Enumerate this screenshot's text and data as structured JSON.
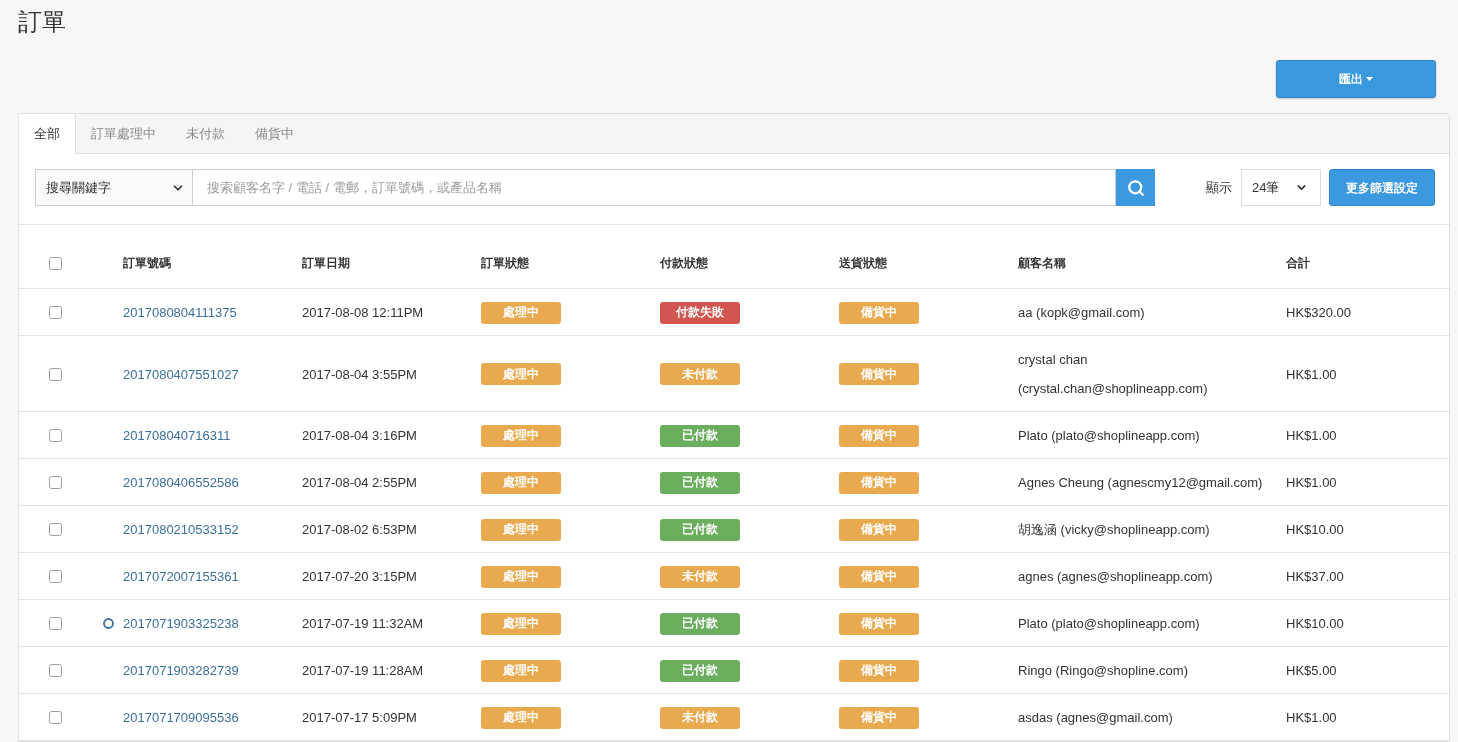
{
  "page": {
    "title": "訂單"
  },
  "export_button": {
    "label": "匯出"
  },
  "tabs": [
    {
      "label": "全部",
      "selected": true
    },
    {
      "label": "訂單處理中",
      "selected": false
    },
    {
      "label": "未付款",
      "selected": false
    },
    {
      "label": "備貨中",
      "selected": false
    }
  ],
  "search": {
    "field_type": "搜尋關鍵字",
    "placeholder": "搜索顧客名字 / 電話 / 電郵，訂單號碼，或產品名稱"
  },
  "page_size": {
    "label": "顯示",
    "value": "24筆"
  },
  "filter_button": {
    "label": "更多篩選設定"
  },
  "table": {
    "select_all_checked": false,
    "columns": [
      "訂單號碼",
      "訂單日期",
      "訂單狀態",
      "付款狀態",
      "送貨狀態",
      "顧客名稱",
      "合計"
    ],
    "rows": [
      {
        "checked": false,
        "marked": false,
        "order_no": "2017080804111375",
        "date": "2017-08-08 12:11PM",
        "order_status": {
          "label": "處理中",
          "color": "#e8a94f"
        },
        "payment_status": {
          "label": "付款失敗",
          "color": "#d0564f"
        },
        "delivery_status": {
          "label": "備貨中",
          "color": "#e8a94f"
        },
        "customer": "aa (kopk@gmail.com)",
        "total": "HK$320.00"
      },
      {
        "checked": false,
        "marked": false,
        "order_no": "2017080407551027",
        "date": "2017-08-04 3:55PM",
        "order_status": {
          "label": "處理中",
          "color": "#e8a94f"
        },
        "payment_status": {
          "label": "未付款",
          "color": "#e8a94f"
        },
        "delivery_status": {
          "label": "備貨中",
          "color": "#e8a94f"
        },
        "customer": "crystal chan (crystal.chan@shoplineapp.com)",
        "total": "HK$1.00"
      },
      {
        "checked": false,
        "marked": false,
        "order_no": "201708040716311",
        "date": "2017-08-04 3:16PM",
        "order_status": {
          "label": "處理中",
          "color": "#e8a94f"
        },
        "payment_status": {
          "label": "已付款",
          "color": "#6aae5e"
        },
        "delivery_status": {
          "label": "備貨中",
          "color": "#e8a94f"
        },
        "customer": "Plato (plato@shoplineapp.com)",
        "total": "HK$1.00"
      },
      {
        "checked": false,
        "marked": false,
        "order_no": "2017080406552586",
        "date": "2017-08-04 2:55PM",
        "order_status": {
          "label": "處理中",
          "color": "#e8a94f"
        },
        "payment_status": {
          "label": "已付款",
          "color": "#6aae5e"
        },
        "delivery_status": {
          "label": "備貨中",
          "color": "#e8a94f"
        },
        "customer": "Agnes Cheung (agnescmy12@gmail.com)",
        "total": "HK$1.00"
      },
      {
        "checked": false,
        "marked": false,
        "order_no": "2017080210533152",
        "date": "2017-08-02 6:53PM",
        "order_status": {
          "label": "處理中",
          "color": "#e8a94f"
        },
        "payment_status": {
          "label": "已付款",
          "color": "#6aae5e"
        },
        "delivery_status": {
          "label": "備貨中",
          "color": "#e8a94f"
        },
        "customer": "胡逸涵 (vicky@shoplineapp.com)",
        "total": "HK$10.00"
      },
      {
        "checked": false,
        "marked": false,
        "order_no": "2017072007155361",
        "date": "2017-07-20 3:15PM",
        "order_status": {
          "label": "處理中",
          "color": "#e8a94f"
        },
        "payment_status": {
          "label": "未付款",
          "color": "#e8a94f"
        },
        "delivery_status": {
          "label": "備貨中",
          "color": "#e8a94f"
        },
        "customer": "agnes (agnes@shoplineapp.com)",
        "total": "HK$37.00"
      },
      {
        "checked": false,
        "marked": true,
        "order_no": "2017071903325238",
        "date": "2017-07-19 11:32AM",
        "order_status": {
          "label": "處理中",
          "color": "#e8a94f"
        },
        "payment_status": {
          "label": "已付款",
          "color": "#6aae5e"
        },
        "delivery_status": {
          "label": "備貨中",
          "color": "#e8a94f"
        },
        "customer": "Plato (plato@shoplineapp.com)",
        "total": "HK$10.00"
      },
      {
        "checked": false,
        "marked": false,
        "order_no": "2017071903282739",
        "date": "2017-07-19 11:28AM",
        "order_status": {
          "label": "處理中",
          "color": "#e8a94f"
        },
        "payment_status": {
          "label": "已付款",
          "color": "#6aae5e"
        },
        "delivery_status": {
          "label": "備貨中",
          "color": "#e8a94f"
        },
        "customer": "Ringo (Ringo@shopline.com)",
        "total": "HK$5.00"
      },
      {
        "checked": false,
        "marked": false,
        "order_no": "2017071709095536",
        "date": "2017-07-17 5:09PM",
        "order_status": {
          "label": "處理中",
          "color": "#e8a94f"
        },
        "payment_status": {
          "label": "未付款",
          "color": "#e8a94f"
        },
        "delivery_status": {
          "label": "備貨中",
          "color": "#e8a94f"
        },
        "customer": "asdas (agnes@gmail.com)",
        "total": "HK$1.00"
      }
    ]
  }
}
